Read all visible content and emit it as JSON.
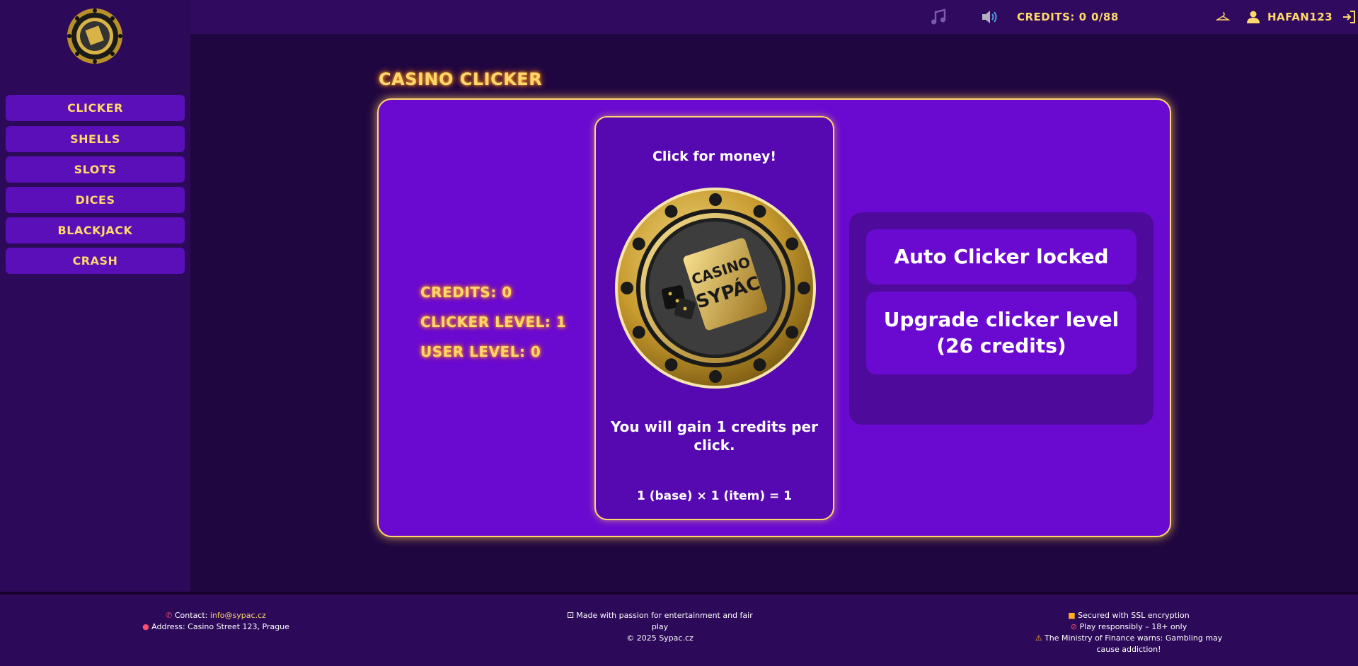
{
  "sidebar": {
    "logo_icon": "casino-chip-logo-icon",
    "items": [
      {
        "label": "CLICKER"
      },
      {
        "label": "SHELLS"
      },
      {
        "label": "SLOTS"
      },
      {
        "label": "DICES"
      },
      {
        "label": "BLACKJACK"
      },
      {
        "label": "CRASH"
      }
    ]
  },
  "topbar": {
    "music_icon": "music-note-icon",
    "sound_icon": "speaker-icon",
    "credits": "CREDITS: 0",
    "progress": "0/88",
    "extra_icon": "hanger-icon",
    "user_icon": "user-icon",
    "username": "HAFAN123",
    "logout_icon": "logout-icon"
  },
  "page": {
    "title": "CASINO CLICKER"
  },
  "stats": {
    "credits": "CREDITS: 0",
    "clicker_level": "CLICKER LEVEL: 1",
    "user_level": "USER LEVEL: 0"
  },
  "click_card": {
    "heading": "Click for money!",
    "gain_line1": "You will gain 1 credits per",
    "gain_line2": "click.",
    "formula": "1 (base) × 1 (item) = 1",
    "chip_icon": "casino-chip-icon",
    "chip_text1": "CASINO",
    "chip_text2": "SYPÁC"
  },
  "upgrades": {
    "auto_clicker": "Auto Clicker locked",
    "upgrade_line1": "Upgrade clicker level",
    "upgrade_line2": "(26 credits)"
  },
  "footer": {
    "contact_label": "Contact: ",
    "contact_email": "info@sypac.cz",
    "address": "Address: Casino Street 123, Prague",
    "made_line1": "Made with passion for entertainment and fair",
    "made_line2": "play",
    "copyright": "© 2025 Sypac.cz",
    "ssl": "Secured with SSL encryption",
    "responsible": "Play responsibly – 18+ only",
    "warn_line1": "The Ministry of Finance warns: Gambling may",
    "warn_line2": "cause addiction!"
  },
  "colors": {
    "accent": "#ffd86b",
    "panel": "#6a0ad0",
    "sidebar": "#2c0a59",
    "background": "#1f0640"
  }
}
